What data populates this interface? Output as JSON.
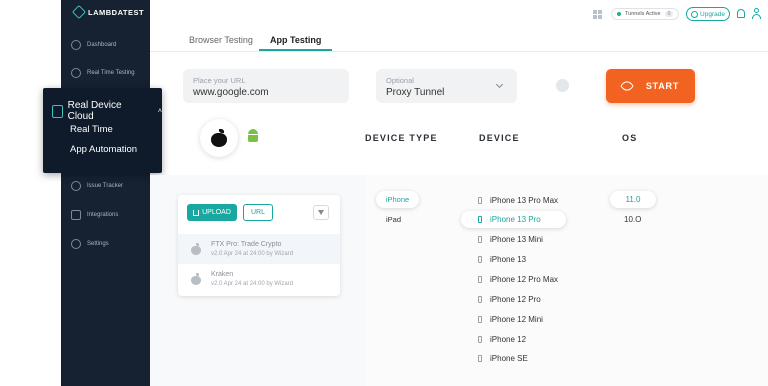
{
  "brand": {
    "name": "LAMBDATEST"
  },
  "sidebar": {
    "items": [
      {
        "label": "Dashboard",
        "icon": "dashboard-icon"
      },
      {
        "label": "Real Time Testing",
        "icon": "realtime-icon"
      },
      {
        "label": "Issue Tracker",
        "icon": "bug-icon"
      },
      {
        "label": "Integrations",
        "icon": "integrations-icon"
      },
      {
        "label": "Settings",
        "icon": "gear-icon"
      }
    ]
  },
  "popup": {
    "title": "Real Device Cloud",
    "items": [
      {
        "label": "Real Time"
      },
      {
        "label": "App Automation"
      }
    ]
  },
  "topbar": {
    "tunnel_status": "Tunnels Active",
    "tunnel_count": "0",
    "upgrade_label": "Upgrade"
  },
  "tabs": [
    {
      "label": "Browser Testing",
      "active": false
    },
    {
      "label": "App Testing",
      "active": true
    }
  ],
  "url_input": {
    "placeholder": "Place your URL",
    "value": "www.google.com"
  },
  "proxy": {
    "placeholder": "Optional",
    "value": "Proxy Tunnel"
  },
  "start_label": "START",
  "os_options": [
    {
      "name": "apple-icon",
      "selected": true
    },
    {
      "name": "android-icon",
      "selected": false
    }
  ],
  "columns": {
    "device_type": "DEVICE TYPE",
    "device": "DEVICE",
    "os": "OS"
  },
  "app_panel": {
    "upload_label": "UPLOAD",
    "url_label": "URL",
    "apps": [
      {
        "name": "FTX Pro: Trade Crypto",
        "meta": "v2.0 Apr 24 at 24:00 by Wizard",
        "selected": true
      },
      {
        "name": "Kraken",
        "meta": "v2.0 Apr 24 at 24:00 by Wizard",
        "selected": false
      }
    ]
  },
  "device_types": [
    {
      "label": "iPhone",
      "selected": true
    },
    {
      "label": "iPad",
      "selected": false
    }
  ],
  "devices": [
    {
      "label": "iPhone 13 Pro Max",
      "selected": false
    },
    {
      "label": "iPhone 13 Pro",
      "selected": true
    },
    {
      "label": "iPhone 13 Mini",
      "selected": false
    },
    {
      "label": "iPhone 13",
      "selected": false
    },
    {
      "label": "iPhone 12 Pro Max",
      "selected": false
    },
    {
      "label": "iPhone 12 Pro",
      "selected": false
    },
    {
      "label": "iPhone 12 Mini",
      "selected": false
    },
    {
      "label": "iPhone 12",
      "selected": false
    },
    {
      "label": "iPhone SE",
      "selected": false
    }
  ],
  "os_versions": [
    {
      "label": "11.0",
      "selected": true
    },
    {
      "label": "10.O",
      "selected": false
    }
  ],
  "colors": {
    "accent": "#18a7a1",
    "start": "#f26322",
    "sidebar": "#162131"
  }
}
